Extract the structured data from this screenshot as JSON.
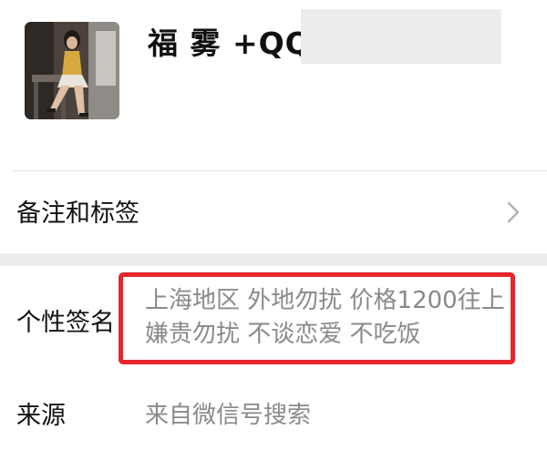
{
  "profile": {
    "name": "福 雾 +QQ"
  },
  "remark": {
    "label": "备注和标签"
  },
  "signature": {
    "label": "个性签名",
    "value": "上海地区 外地勿扰 价格1200往上 嫌贵勿扰 不谈恋爱 不吃饭"
  },
  "source": {
    "label": "来源",
    "value": "来自微信号搜索"
  },
  "icons": {
    "chevron": "chevron-right-icon"
  },
  "colors": {
    "highlight_border": "#e8262c",
    "secondary_text": "#8a8a8a",
    "section_gap": "#ededed"
  }
}
